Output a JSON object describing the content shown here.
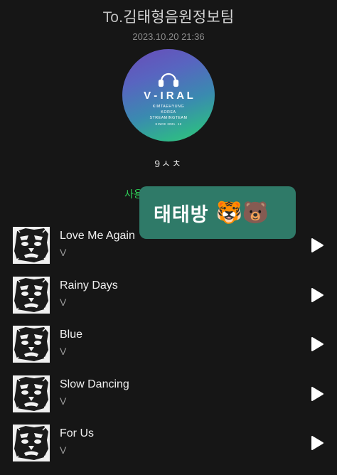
{
  "header": {
    "title_prefix": "To.",
    "title": "김태형음원정보팀",
    "timestamp": "2023.10.20 21:36"
  },
  "logo": {
    "main_text": "V - I R A L",
    "line1": "KIMTAEHYUNG",
    "line2": "KOREA",
    "line3": "STREAMINGTEAM",
    "since": "SINCE 2021. 12"
  },
  "caption": "9ㅅㅊ",
  "validity_label": "사용 유효기간 |  -",
  "toast": {
    "text": "태태방",
    "emoji": "🐯🐻"
  },
  "tracks": [
    {
      "title": "Love Me Again",
      "artist": "V"
    },
    {
      "title": "Rainy Days",
      "artist": "V"
    },
    {
      "title": "Blue",
      "artist": "V"
    },
    {
      "title": "Slow Dancing",
      "artist": "V"
    },
    {
      "title": "For Us",
      "artist": "V"
    }
  ],
  "colors": {
    "background": "#161616",
    "validity_green": "#2ed158",
    "toast_bg": "#2f7a68"
  },
  "icons": {
    "play": "play-icon",
    "headphones": "headphones-icon"
  }
}
